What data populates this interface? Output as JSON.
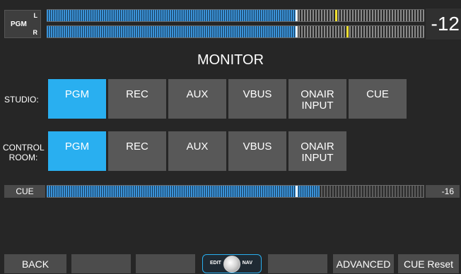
{
  "pgm_meter": {
    "label": "PGM",
    "channel_l": "L",
    "channel_r": "R",
    "value": "-12"
  },
  "title": "MONITOR",
  "studio": {
    "label": "STUDIO:",
    "buttons": [
      "PGM",
      "REC",
      "AUX",
      "VBUS",
      "ONAIR\nINPUT",
      "CUE"
    ],
    "selected": "PGM"
  },
  "control_room": {
    "label": "CONTROL\nROOM:",
    "buttons": [
      "PGM",
      "REC",
      "AUX",
      "VBUS",
      "ONAIR\nINPUT"
    ],
    "selected": "PGM"
  },
  "cue_meter": {
    "label": "CUE",
    "value": "-16"
  },
  "bottom": {
    "back": "BACK",
    "edit": "EDIT",
    "nav": "NAV",
    "advanced": "ADVANCED",
    "cue_reset": "CUE Reset"
  },
  "colors": {
    "active": "#29aff0",
    "button": "#585858",
    "background": "#262626",
    "meter_fill": "#3b93d8",
    "peak": "#f2e030"
  },
  "icons": {
    "edit_nav_knob": "rotary-knob-icon"
  }
}
